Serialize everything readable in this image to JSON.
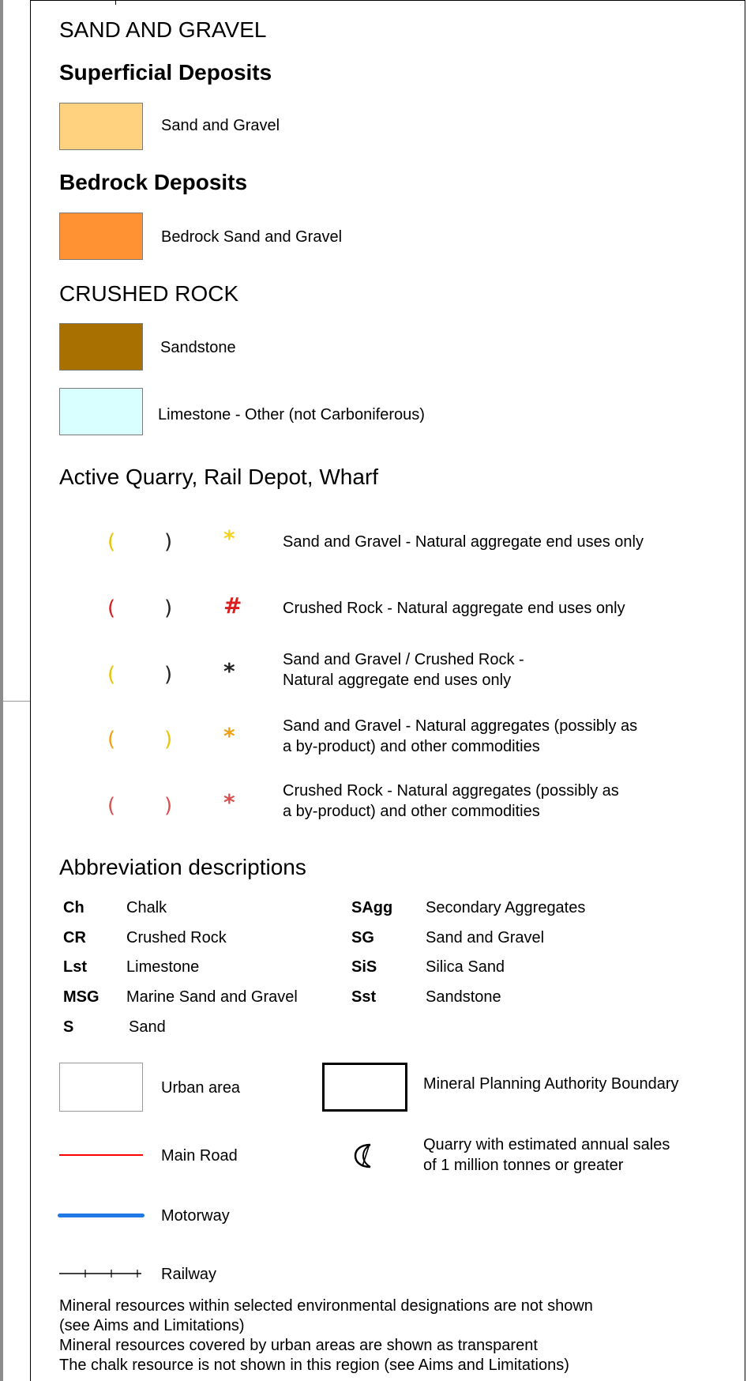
{
  "colors": {
    "sand_gravel": "#ffd27f",
    "bedrock_sand_gravel": "#ff9233",
    "sandstone": "#a87000",
    "limestone_other": "#d9ffff",
    "main_road": "#ff0000",
    "motorway": "#1f78e6",
    "symbol_yellow": "#f5d21e",
    "symbol_red": "#d81e1e",
    "symbol_orange": "#f0a014"
  },
  "sections": {
    "sand_and_gravel": "SAND AND GRAVEL",
    "superficial": "Superficial Deposits",
    "bedrock": "Bedrock Deposits",
    "crushed_rock": "CRUSHED ROCK",
    "active_quarry": "Active Quarry, Rail Depot, Wharf",
    "abbreviations": "Abbreviation descriptions"
  },
  "swatches": {
    "sand_gravel": "Sand and Gravel",
    "bedrock_sand_gravel": "Bedrock Sand and Gravel",
    "sandstone": "Sandstone",
    "limestone_other": "Limestone - Other (not Carboniferous)"
  },
  "quarry_symbols": [
    {
      "label": "Sand and Gravel - Natural aggregate end uses only",
      "line2": "",
      "icon_color": "yellow"
    },
    {
      "label": "Crushed Rock - Natural aggregate end uses only",
      "line2": "",
      "icon_color": "red"
    },
    {
      "label": "Sand and Gravel / Crushed Rock -",
      "line2": "Natural aggregate end uses only",
      "icon_color": "black-yellow"
    },
    {
      "label": "Sand and Gravel - Natural aggregates (possibly as",
      "line2": "a by-product) and other commodities",
      "icon_color": "orange"
    },
    {
      "label": "Crushed Rock - Natural aggregates (possibly as",
      "line2": "a by-product) and other commodities",
      "icon_color": "red-light"
    }
  ],
  "abbreviations_left": [
    {
      "code": "Ch",
      "desc": "Chalk"
    },
    {
      "code": "CR",
      "desc": "Crushed Rock"
    },
    {
      "code": "Lst",
      "desc": "Limestone"
    },
    {
      "code": "MSG",
      "desc": "Marine Sand and Gravel"
    },
    {
      "code": "S",
      "desc": "Sand"
    }
  ],
  "abbreviations_right": [
    {
      "code": "SAgg",
      "desc": "Secondary Aggregates"
    },
    {
      "code": "SG",
      "desc": "Sand and Gravel"
    },
    {
      "code": "SiS",
      "desc": "Silica Sand"
    },
    {
      "code": "Sst",
      "desc": "Sandstone"
    }
  ],
  "features": {
    "urban": "Urban area",
    "mpa_boundary": "Mineral Planning Authority Boundary",
    "main_road": "Main Road",
    "quarry_million_line1": "Quarry with estimated annual sales",
    "quarry_million_line2": "of 1 million tonnes or greater",
    "motorway": "Motorway",
    "railway": "Railway"
  },
  "notes": [
    "Mineral resources within selected environmental designations are not shown",
    "(see Aims and Limitations)",
    "Mineral resources covered by urban areas are shown as transparent",
    "The chalk resource is not shown in this region (see Aims and Limitations)"
  ]
}
